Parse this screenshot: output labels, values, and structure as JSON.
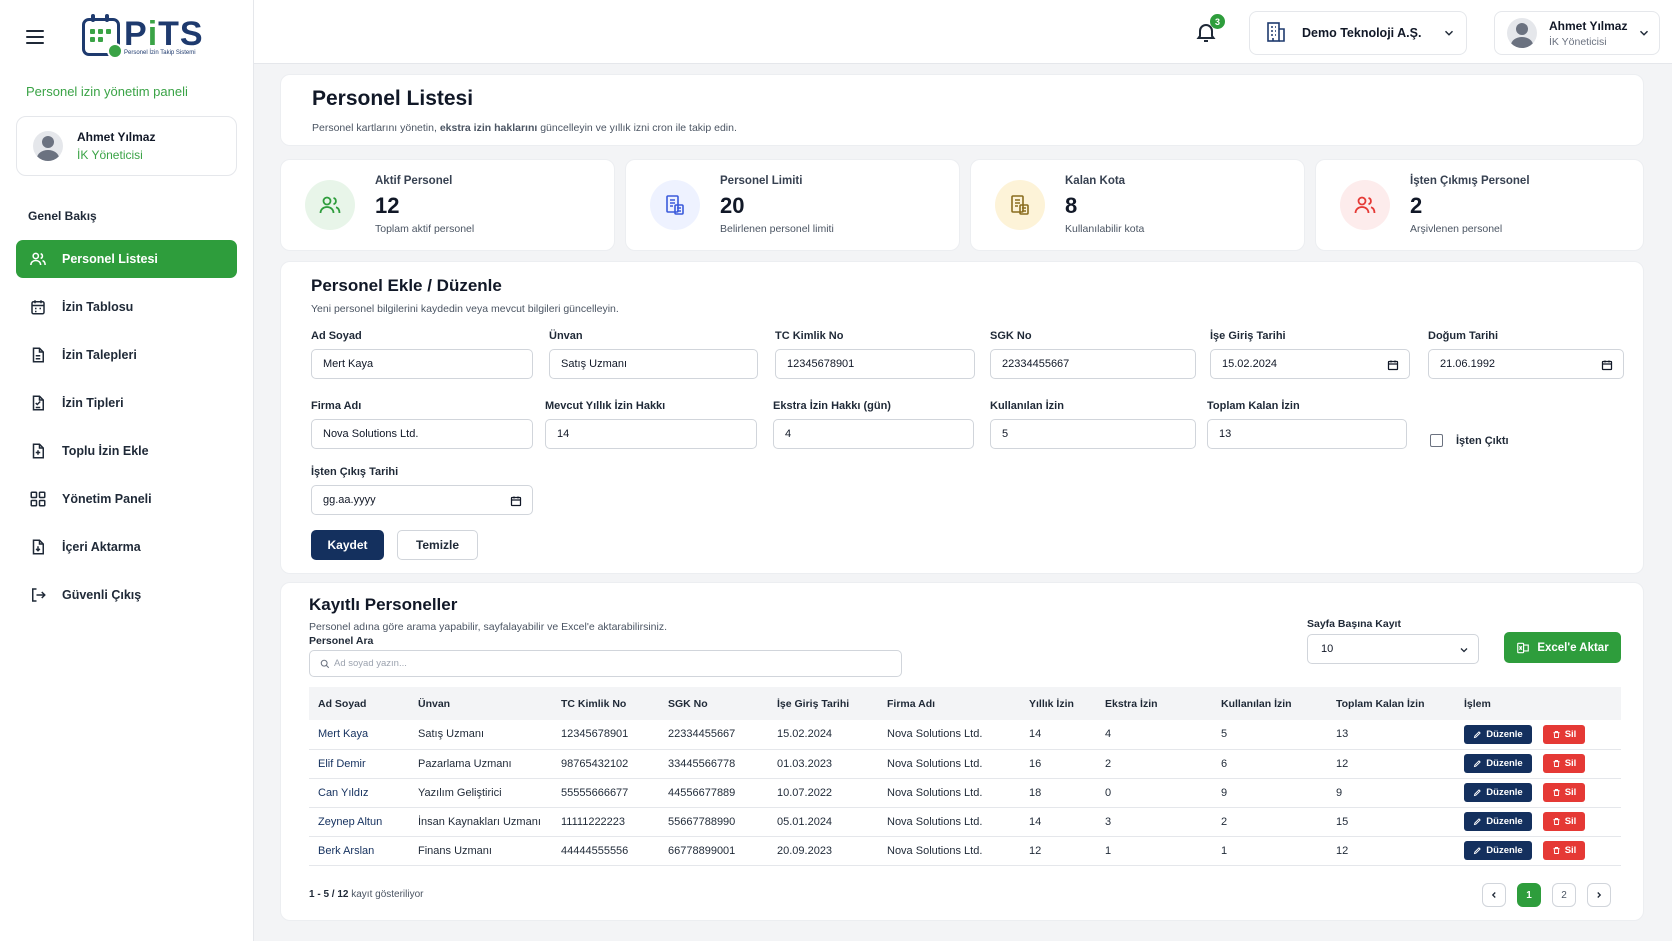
{
  "app": {
    "logo_word_1": "P",
    "logo_word_2": "i",
    "logo_word_3": "TS",
    "logo_sub": "Personel İzin Takip Sistemi",
    "panel_label": "Personel izin yönetim paneli"
  },
  "user": {
    "name": "Ahmet Yılmaz",
    "role": "İK Yöneticisi"
  },
  "sidebar": {
    "section": "Genel Bakış",
    "items": [
      {
        "label": "Personel Listesi",
        "icon": "users-icon"
      },
      {
        "label": "İzin Tablosu",
        "icon": "calendar-icon"
      },
      {
        "label": "İzin Talepleri",
        "icon": "file-icon"
      },
      {
        "label": "İzin Tipleri",
        "icon": "file-list-icon"
      },
      {
        "label": "Toplu İzin Ekle",
        "icon": "file-add-icon"
      },
      {
        "label": "Yönetim Paneli",
        "icon": "grid-icon"
      },
      {
        "label": "İçeri Aktarma",
        "icon": "import-icon"
      },
      {
        "label": "Güvenli Çıkış",
        "icon": "logout-icon"
      }
    ]
  },
  "topbar": {
    "notif_count": "3",
    "company": "Demo Teknoloji A.Ş."
  },
  "page": {
    "title": "Personel Listesi",
    "subtitle_a": "Personel kartlarını yönetin, ",
    "subtitle_b": "ekstra izin haklarını",
    "subtitle_c": " güncelleyin ve yıllık izni cron ile takip edin."
  },
  "stats": [
    {
      "label": "Aktif Personel",
      "value": "12",
      "desc": "Toplam aktif personel",
      "color": "#2e9d3c",
      "bg": "#e8f5e9"
    },
    {
      "label": "Personel Limiti",
      "value": "20",
      "desc": "Belirlenen personel limiti",
      "color": "#3b5bdb",
      "bg": "#eef2ff"
    },
    {
      "label": "Kalan Kota",
      "value": "8",
      "desc": "Kullanılabilir kota",
      "color": "#8a6d1f",
      "bg": "#fdf3d8"
    },
    {
      "label": "İşten Çıkmış Personel",
      "value": "2",
      "desc": "Arşivlenen personel",
      "color": "#e53935",
      "bg": "#fdecec"
    }
  ],
  "form": {
    "title": "Personel Ekle / Düzenle",
    "subtitle": "Yeni personel bilgilerini kaydedin veya mevcut bilgileri güncelleyin.",
    "ad_soyad": {
      "label": "Ad Soyad",
      "value": "Mert Kaya"
    },
    "unvan": {
      "label": "Ünvan",
      "value": "Satış Uzmanı"
    },
    "tc": {
      "label": "TC Kimlik No",
      "value": "12345678901"
    },
    "sgk": {
      "label": "SGK No",
      "value": "22334455667"
    },
    "ise_giris": {
      "label": "İşe Giriş Tarihi",
      "value": "15.02.2024"
    },
    "dogum": {
      "label": "Doğum Tarihi",
      "value": "21.06.1992"
    },
    "firma": {
      "label": "Firma Adı",
      "value": "Nova Solutions Ltd."
    },
    "yillik": {
      "label": "Mevcut Yıllık İzin Hakkı",
      "value": "14"
    },
    "ekstra": {
      "label": "Ekstra İzin Hakkı (gün)",
      "value": "4"
    },
    "kullanilan": {
      "label": "Kullanılan İzin",
      "value": "5"
    },
    "toplam": {
      "label": "Toplam Kalan İzin",
      "value": "13"
    },
    "isten_cikti": "İşten Çıktı",
    "cikis": {
      "label": "İşten Çıkış Tarihi",
      "value": "gg.aa.yyyy"
    },
    "save": "Kaydet",
    "clear": "Temizle"
  },
  "list": {
    "title": "Kayıtlı Personeller",
    "subtitle": "Personel adına göre arama yapabilir, sayfalayabilir ve Excel'e aktarabilirsiniz.",
    "search_label": "Personel Ara",
    "search_placeholder": "Ad soyad yazın...",
    "per_page_label": "Sayfa Başına Kayıt",
    "per_page_value": "10",
    "excel": "Excel'e Aktar",
    "columns": [
      "Ad Soyad",
      "Ünvan",
      "TC Kimlik No",
      "SGK No",
      "İşe Giriş Tarihi",
      "Firma Adı",
      "Yıllık İzin",
      "Ekstra İzin",
      "Kullanılan İzin",
      "Toplam Kalan İzin",
      "İşlem"
    ],
    "rows": [
      [
        "Mert Kaya",
        "Satış Uzmanı",
        "12345678901",
        "22334455667",
        "15.02.2024",
        "Nova Solutions Ltd.",
        "14",
        "4",
        "5",
        "13"
      ],
      [
        "Elif Demir",
        "Pazarlama Uzmanı",
        "98765432102",
        "33445566778",
        "01.03.2023",
        "Nova Solutions Ltd.",
        "16",
        "2",
        "6",
        "12"
      ],
      [
        "Can Yıldız",
        "Yazılım Geliştirici",
        "55555666677",
        "44556677889",
        "10.07.2022",
        "Nova Solutions Ltd.",
        "18",
        "0",
        "9",
        "9"
      ],
      [
        "Zeynep Altun",
        "İnsan Kaynakları Uzmanı",
        "11111222223",
        "55667788990",
        "05.01.2024",
        "Nova Solutions Ltd.",
        "14",
        "3",
        "2",
        "15"
      ],
      [
        "Berk Arslan",
        "Finans Uzmanı",
        "44444555556",
        "66778899001",
        "20.09.2023",
        "Nova Solutions Ltd.",
        "12",
        "1",
        "1",
        "12"
      ]
    ],
    "edit": "Düzenle",
    "delete": "Sil",
    "rec_range": "1 - 5 / 12",
    "rec_suffix": " kayıt gösteriliyor",
    "pages": [
      "1",
      "2"
    ]
  }
}
